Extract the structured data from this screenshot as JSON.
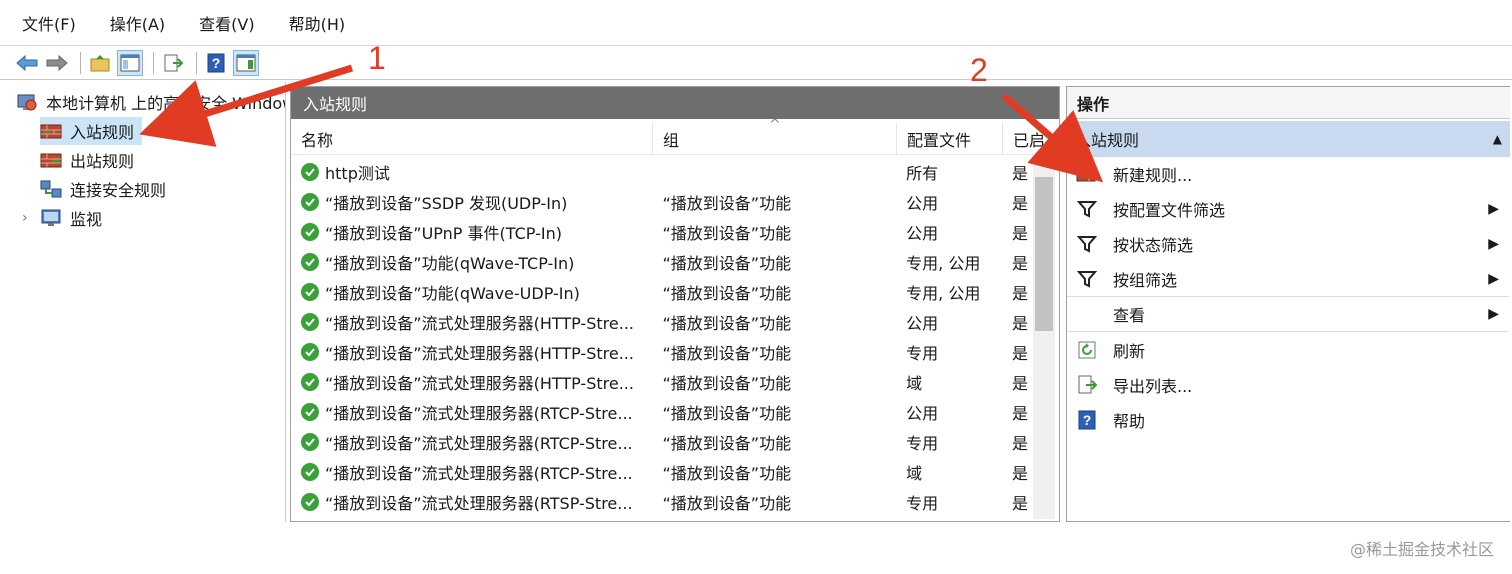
{
  "menu": [
    "文件(F)",
    "操作(A)",
    "查看(V)",
    "帮助(H)"
  ],
  "tree": {
    "root_label": "本地计算机 上的高级安全 Windows",
    "items": [
      {
        "label": "入站规则",
        "selected": true
      },
      {
        "label": "出站规则",
        "selected": false
      },
      {
        "label": "连接安全规则",
        "selected": false
      },
      {
        "label": "监视",
        "selected": false
      }
    ]
  },
  "middle": {
    "title": "入站规则",
    "columns": [
      "名称",
      "组",
      "配置文件",
      "已启"
    ],
    "rows": [
      {
        "name": "http测试",
        "group": "",
        "profile": "所有",
        "enabled": "是"
      },
      {
        "name": "“播放到设备”SSDP 发现(UDP-In)",
        "group": "“播放到设备”功能",
        "profile": "公用",
        "enabled": "是"
      },
      {
        "name": "“播放到设备”UPnP 事件(TCP-In)",
        "group": "“播放到设备”功能",
        "profile": "公用",
        "enabled": "是"
      },
      {
        "name": "“播放到设备”功能(qWave-TCP-In)",
        "group": "“播放到设备”功能",
        "profile": "专用, 公用",
        "enabled": "是"
      },
      {
        "name": "“播放到设备”功能(qWave-UDP-In)",
        "group": "“播放到设备”功能",
        "profile": "专用, 公用",
        "enabled": "是"
      },
      {
        "name": "“播放到设备”流式处理服务器(HTTP-Stre...",
        "group": "“播放到设备”功能",
        "profile": "公用",
        "enabled": "是"
      },
      {
        "name": "“播放到设备”流式处理服务器(HTTP-Stre...",
        "group": "“播放到设备”功能",
        "profile": "专用",
        "enabled": "是"
      },
      {
        "name": "“播放到设备”流式处理服务器(HTTP-Stre...",
        "group": "“播放到设备”功能",
        "profile": "域",
        "enabled": "是"
      },
      {
        "name": "“播放到设备”流式处理服务器(RTCP-Stre...",
        "group": "“播放到设备”功能",
        "profile": "公用",
        "enabled": "是"
      },
      {
        "name": "“播放到设备”流式处理服务器(RTCP-Stre...",
        "group": "“播放到设备”功能",
        "profile": "专用",
        "enabled": "是"
      },
      {
        "name": "“播放到设备”流式处理服务器(RTCP-Stre...",
        "group": "“播放到设备”功能",
        "profile": "域",
        "enabled": "是"
      },
      {
        "name": "“播放到设备”流式处理服务器(RTSP-Stre...",
        "group": "“播放到设备”功能",
        "profile": "专用",
        "enabled": "是"
      }
    ]
  },
  "actions": {
    "header": "操作",
    "section": "入站规则",
    "items": [
      {
        "label": "新建规则...",
        "icon": "new-rule-icon",
        "submenu": false
      },
      {
        "label": "按配置文件筛选",
        "icon": "filter-icon",
        "submenu": true
      },
      {
        "label": "按状态筛选",
        "icon": "filter-icon",
        "submenu": true
      },
      {
        "label": "按组筛选",
        "icon": "filter-icon",
        "submenu": true
      },
      {
        "label": "查看",
        "icon": "",
        "submenu": true
      },
      {
        "label": "刷新",
        "icon": "refresh-icon",
        "submenu": false
      },
      {
        "label": "导出列表...",
        "icon": "export-icon",
        "submenu": false
      },
      {
        "label": "帮助",
        "icon": "help-icon",
        "submenu": false
      }
    ]
  },
  "annotations": [
    "1",
    "2"
  ],
  "watermark": "@稀土掘金技术社区",
  "colors": {
    "accent": "#e23b24",
    "selected": "#cce4f7",
    "section": "#c9daf0",
    "header": "#6e6e6e",
    "check": "#3aa13a"
  }
}
